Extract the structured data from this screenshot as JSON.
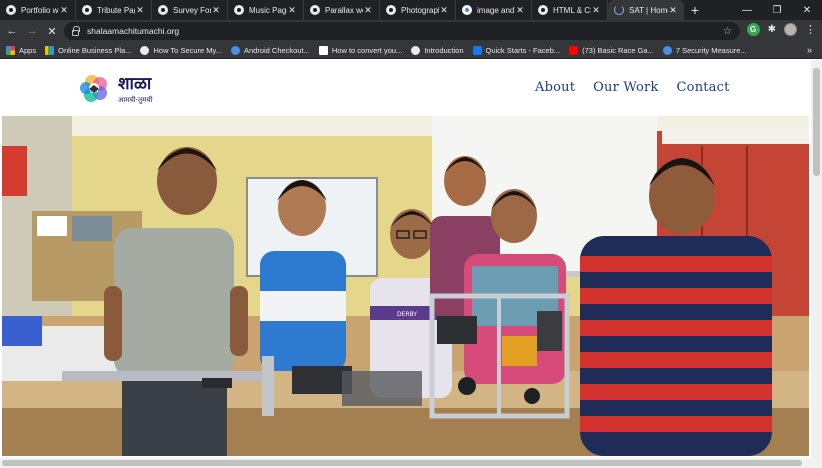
{
  "browser": {
    "tabs": [
      {
        "title": "Portfolio w"
      },
      {
        "title": "Tribute Pag"
      },
      {
        "title": "Survey Form"
      },
      {
        "title": "Music Page"
      },
      {
        "title": "Parallax we"
      },
      {
        "title": "Photograph"
      },
      {
        "title": "image and"
      },
      {
        "title": "HTML & CS"
      },
      {
        "title": "SAT | Home"
      }
    ],
    "url": "shalaamachitumachi.org",
    "bookmarks": [
      {
        "label": "Apps",
        "icon": "apps-grid-icon"
      },
      {
        "label": "Online Business Pla...",
        "icon": "bookmark-icon"
      },
      {
        "label": "How To Secure My...",
        "icon": "globe-icon"
      },
      {
        "label": "Android Checkout...",
        "icon": "android-icon"
      },
      {
        "label": "How to convert you...",
        "icon": "gmail-icon"
      },
      {
        "label": "Introduction",
        "icon": "globe-icon"
      },
      {
        "label": "Quick Starts - Faceb...",
        "icon": "facebook-icon"
      },
      {
        "label": "(73) Basic Race Ga...",
        "icon": "youtube-icon"
      },
      {
        "label": "7 Security Measure...",
        "icon": "globe-icon"
      }
    ],
    "extension_label": "G",
    "more_bookmarks": "»"
  },
  "site": {
    "logo_main": "शाळा",
    "logo_sub": "आमची-तुमची",
    "nav": [
      {
        "label": "About"
      },
      {
        "label": "Our Work"
      },
      {
        "label": "Contact"
      }
    ],
    "hero_alt": "Children standing with robotics projects in a classroom",
    "whiteboard_text": "",
    "shirt_text": "DERBY"
  },
  "colors": {
    "nav_link": "#1e3a8a",
    "chrome_dark": "#202124",
    "chrome_toolbar": "#35363a"
  }
}
